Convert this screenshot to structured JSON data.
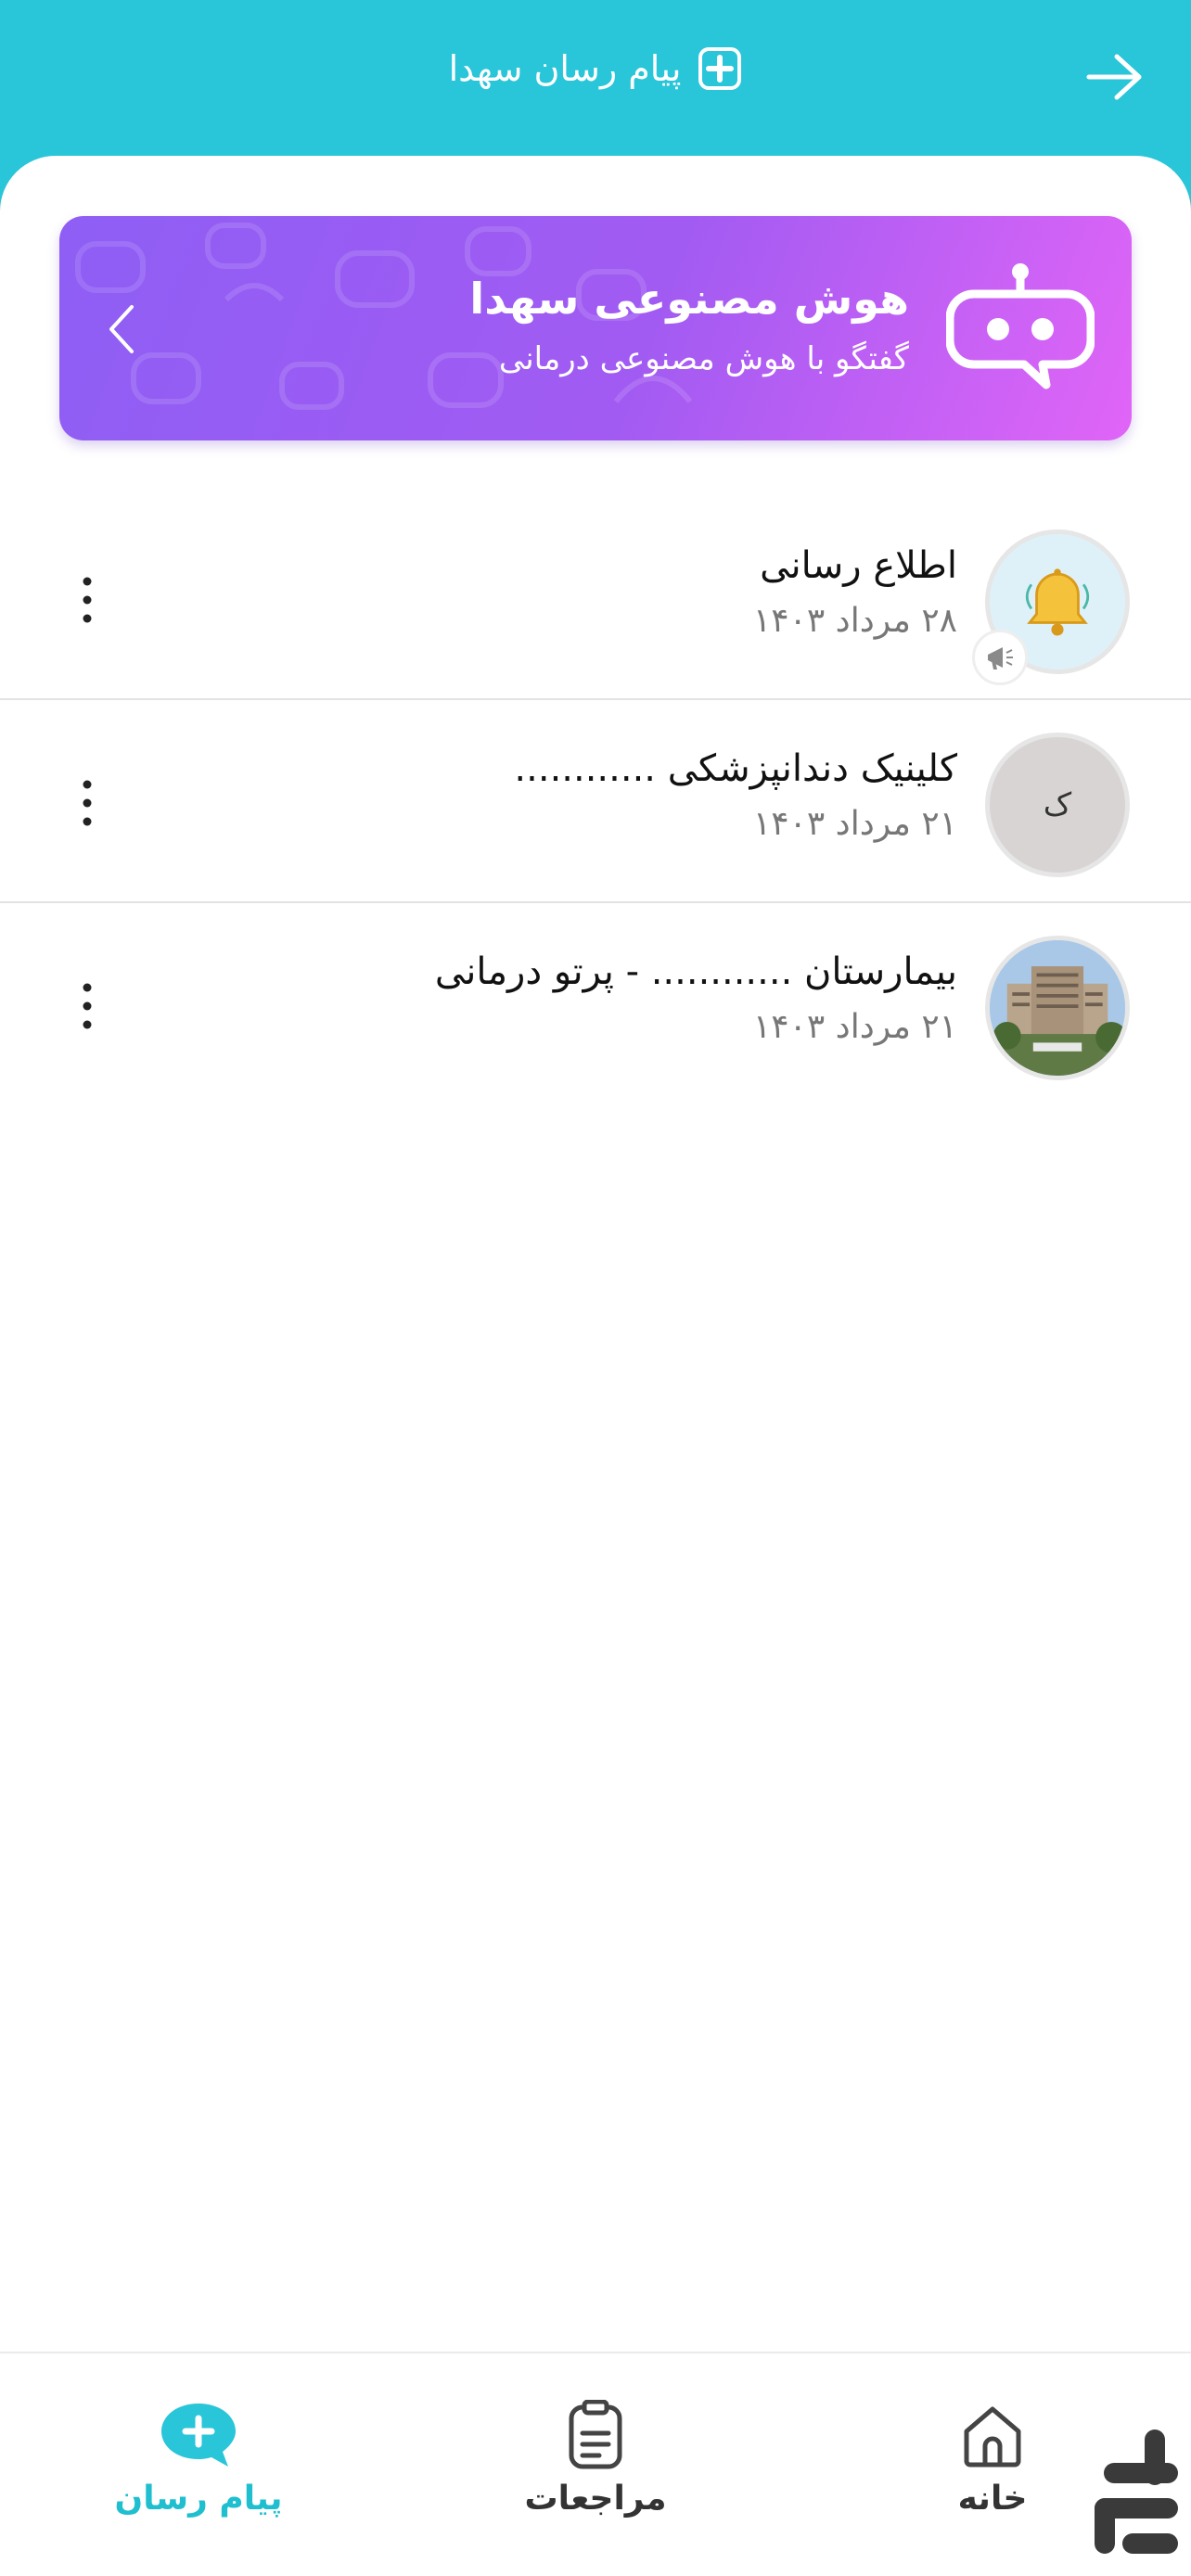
{
  "header": {
    "title": "پیام رسان سهدا",
    "back_icon": "arrow-right-icon",
    "logo_icon": "plus-square-icon"
  },
  "ai_banner": {
    "title": "هوش مصنوعی سهدا",
    "subtitle": "گفتگو با هوش مصنوعی درمانی",
    "icon": "robot-chat-icon",
    "colors": {
      "from": "#8e5ef5",
      "to": "#e065f7"
    }
  },
  "chats": [
    {
      "name": "اطلاع رسانی",
      "date": "۲۸ مرداد ۱۴۰۳",
      "avatar_type": "bell-icon",
      "badge": "megaphone-icon"
    },
    {
      "name": "کلینیک دندانپزشکی ............",
      "date": "۲۱ مرداد ۱۴۰۳",
      "avatar_type": "letter",
      "avatar_letter": "ک"
    },
    {
      "name": "بیمارستان ............ - پرتو درمانی",
      "date": "۲۱ مرداد ۱۴۰۳",
      "avatar_type": "photo"
    }
  ],
  "bottom_nav": {
    "items": [
      {
        "label": "خانه",
        "icon": "home-icon",
        "active": false
      },
      {
        "label": "مراجعات",
        "icon": "clipboard-icon",
        "active": false
      },
      {
        "label": "پیام رسان",
        "icon": "chat-plus-icon",
        "active": true
      }
    ]
  },
  "colors": {
    "primary": "#29c5d9",
    "active_nav": "#1fbfcf",
    "banner_purple": "#a25bf2"
  }
}
